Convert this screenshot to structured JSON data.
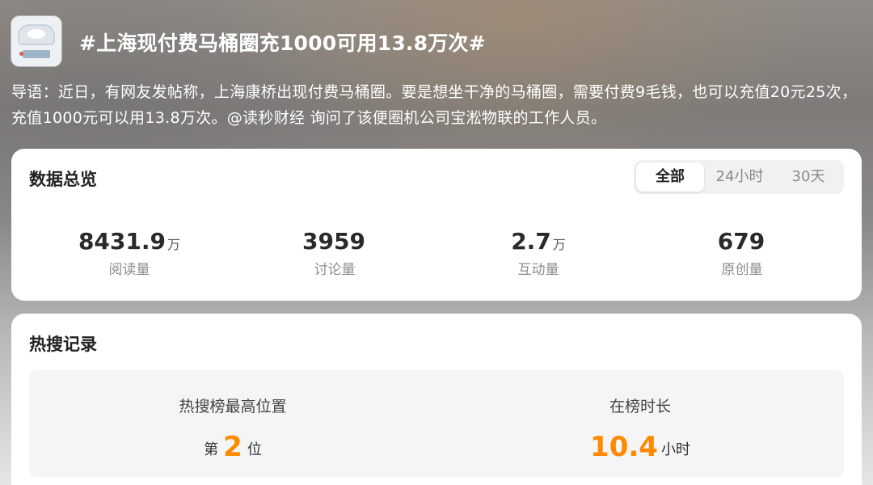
{
  "header": {
    "title": "#上海现付费马桶圈充1000可用13.8万次#",
    "thumbnail_icon": "toilet-seat-thumbnail"
  },
  "intro": "导语：近日，有网友发帖称，上海康桥出现付费马桶圈。要是想坐干净的马桶圈，需要付费9毛钱，也可以充值20元25次，充值1000元可以用13.8万次。@读秒财经 询问了该便圈机公司宝淞物联的工作人员。",
  "overview": {
    "title": "数据总览",
    "tabs": [
      {
        "label": "全部",
        "active": true
      },
      {
        "label": "24小时",
        "active": false
      },
      {
        "label": "30天",
        "active": false
      }
    ],
    "stats": [
      {
        "value": "8431.9",
        "unit": "万",
        "label": "阅读量"
      },
      {
        "value": "3959",
        "unit": "",
        "label": "讨论量"
      },
      {
        "value": "2.7",
        "unit": "万",
        "label": "互动量"
      },
      {
        "value": "679",
        "unit": "",
        "label": "原创量"
      }
    ]
  },
  "hot_search": {
    "title": "热搜记录",
    "highest_position": {
      "label": "热搜榜最高位置",
      "prefix": "第",
      "value": "2",
      "suffix": "位"
    },
    "duration": {
      "label": "在榜时长",
      "value": "10.4",
      "suffix": "小时"
    }
  },
  "colors": {
    "accent": "#ff8a00",
    "card_bg": "#ffffff",
    "text_primary": "#222222",
    "text_secondary": "#8c8c8c"
  }
}
